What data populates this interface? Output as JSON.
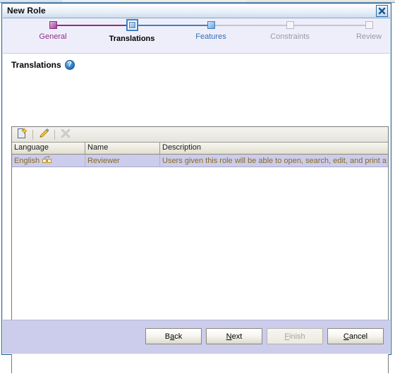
{
  "window": {
    "title": "New Role",
    "close_icon": "close-icon"
  },
  "wizard": {
    "steps": [
      {
        "label": "General",
        "state": "done"
      },
      {
        "label": "Translations",
        "state": "current"
      },
      {
        "label": "Features",
        "state": "next"
      },
      {
        "label": "Constraints",
        "state": "future"
      },
      {
        "label": "Review",
        "state": "future"
      }
    ],
    "colors": {
      "done": "#8c2f86",
      "current": "#000000",
      "next": "#2f6fb5",
      "future": "#9a9aa6"
    }
  },
  "section": {
    "title": "Translations",
    "help_icon": "help-icon",
    "help_glyph": "?"
  },
  "toolbar": {
    "buttons": [
      {
        "name": "new-translation-button",
        "icon": "new-document-icon",
        "enabled": true
      },
      {
        "name": "edit-translation-button",
        "icon": "pencil-icon",
        "enabled": true
      },
      {
        "name": "delete-translation-button",
        "icon": "delete-x-icon",
        "enabled": false
      }
    ]
  },
  "table": {
    "columns": [
      "Language",
      "Name",
      "Description"
    ],
    "rows": [
      {
        "language": "English",
        "language_icon": "translate-icon",
        "name": "Reviewer",
        "description": "Users given this role will be able to open, search, edit, and print a",
        "selected": true
      }
    ],
    "row_text_color": "#8a6a20",
    "selected_row_color": "#ccccec"
  },
  "footer": {
    "buttons": [
      {
        "label": "Back",
        "mnemonic": "a",
        "enabled": true
      },
      {
        "label": "Next",
        "mnemonic": "N",
        "enabled": true
      },
      {
        "label": "Finish",
        "mnemonic": "F",
        "enabled": false
      },
      {
        "label": "Cancel",
        "mnemonic": "C",
        "enabled": true
      }
    ]
  }
}
